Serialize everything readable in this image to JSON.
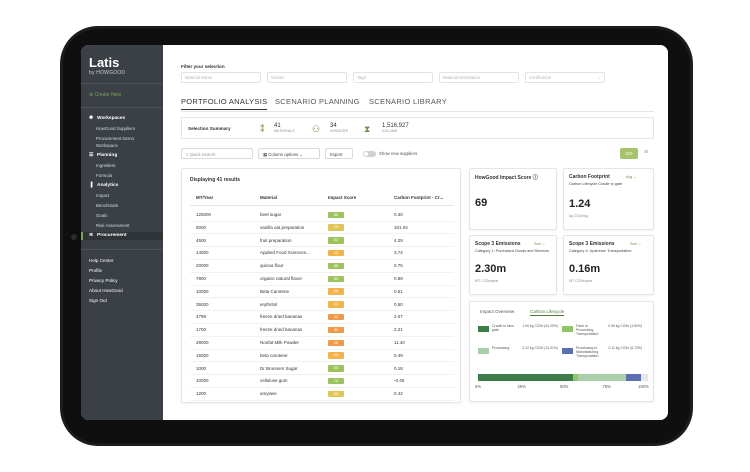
{
  "sidebar": {
    "logo": "Latis",
    "logo_sub": "by HOWGOOD",
    "create_new": "Create New",
    "workspaces": {
      "label": "Workspaces",
      "items": [
        "HowGood Suppliers",
        "Procurement Demo",
        "Workspace"
      ]
    },
    "planning": {
      "label": "Planning",
      "items": [
        "Ingredient",
        "Formula"
      ]
    },
    "analytics": {
      "label": "Analytics",
      "items": [
        "Impact",
        "Benchmark",
        "Goals",
        "Risk Assessment"
      ]
    },
    "procurement": "Procurement",
    "footer": [
      "Help Center",
      "Profile",
      "Privacy Policy",
      "About HowGood",
      "Sign Out"
    ]
  },
  "filter": {
    "title": "Filter your selection",
    "placeholders": [
      "Material Name",
      "Vendor",
      "Tags",
      "Material Destination",
      "Certification"
    ]
  },
  "tabs": [
    "PORTFOLIO ANALYSIS",
    "SCENARIO PLANNING",
    "SCENARIO LIBRARY"
  ],
  "summary": {
    "label": "Selection Summary",
    "materials": {
      "value": "41",
      "label": "MATERIALS"
    },
    "vendors": {
      "value": "34",
      "label": "VENDORS"
    },
    "volume": {
      "value": "1,516,927",
      "label": "VOLUME"
    }
  },
  "controls": {
    "search": "Quick Search",
    "columns": "Column options",
    "export": "Export",
    "toggle": "Show new suppliers",
    "go": "GO"
  },
  "table": {
    "title": "Displaying 41 results",
    "headers": [
      "MT/Year",
      "Material",
      "Impact Score",
      "Carbon Footprint - Cr..."
    ],
    "rows": [
      [
        "125000",
        "beet sugar",
        "65",
        "0.30"
      ],
      [
        "5000",
        "vanilla oat preparation",
        "45",
        "101.04"
      ],
      [
        "4500",
        "fruit preparation",
        "62",
        "4.29"
      ],
      [
        "14000",
        "Applied Food Sciences...",
        "40",
        "3.74"
      ],
      [
        "20000",
        "quinoa flour",
        "68",
        "0.75"
      ],
      [
        "7800",
        "organic natural flavor",
        "63",
        "0.89"
      ],
      [
        "10000",
        "Beta Carotene",
        "38",
        "0.51"
      ],
      [
        "35000",
        "erythritol",
        "43",
        "0.50"
      ],
      [
        "4799",
        "freeze dried bananas",
        "32",
        "2.07"
      ],
      [
        "1700",
        "freeze dried bananas",
        "32",
        "2.21"
      ],
      [
        "29000",
        "Nonfat Milk Powder",
        "25",
        "11.40"
      ],
      [
        "15000",
        "beta carotene",
        "40",
        "0.49"
      ],
      [
        "1000",
        "Dr Bronners Sugar",
        "66",
        "0.18"
      ],
      [
        "10000",
        "cellulose gum",
        "70",
        "-0.48"
      ],
      [
        "1200",
        "amylase",
        "50",
        "0.42"
      ]
    ]
  },
  "metrics": {
    "impact": {
      "title": "HowGood Impact Score",
      "value": "69"
    },
    "carbon": {
      "title": "Carbon Footprint",
      "sub": "Carbon Lifecycle Cradle to gate",
      "dd": "Avg",
      "value": "1.24",
      "unit": "kg CO2e/kg"
    },
    "scope3a": {
      "title": "Scope 3 Emissions",
      "dd": "Sum",
      "sub": "Category 1: Purchased Goods and Services",
      "value": "2.30m",
      "unit": "MT CO2e/year"
    },
    "scope3b": {
      "title": "Scope 3 Emissions",
      "dd": "Sum",
      "sub": "Category 4: Upstream Transportation",
      "value": "0.16m",
      "unit": "MT CO2e/year"
    }
  },
  "lifecycle": {
    "tabs": [
      "Impact Overview",
      "Carbon Lifecycle"
    ],
    "items": [
      {
        "label": "Cradle to farm gate",
        "value": "1.06 kg CO2e (64.29%)",
        "color": "#3d7d4a"
      },
      {
        "label": "Farm to Processing Transportation",
        "value": "0.06 kg CO2e (3.82%)",
        "color": "#8fc467"
      },
      {
        "label": "Processing",
        "value": "0.22 kg CO2e (13.31%)",
        "color": "#a9cfa8"
      },
      {
        "label": "Processing to Manufacturing Transportation",
        "value": "0.11 kg CO2e (6.73%)",
        "color": "#5c6fb0"
      }
    ],
    "bar_segments": [
      {
        "pct": 56,
        "color": "#3d7d4a"
      },
      {
        "pct": 3,
        "color": "#8fc467"
      },
      {
        "pct": 28,
        "color": "#a9cfa8"
      },
      {
        "pct": 9,
        "color": "#5c6fb0"
      },
      {
        "pct": 4,
        "color": "#e5e7e9"
      }
    ],
    "ticks": [
      "0%",
      "25%",
      "50%",
      "75%",
      "100%"
    ]
  },
  "colors": {
    "accent": "#7aa35a",
    "sidebar": "#3a4045"
  }
}
